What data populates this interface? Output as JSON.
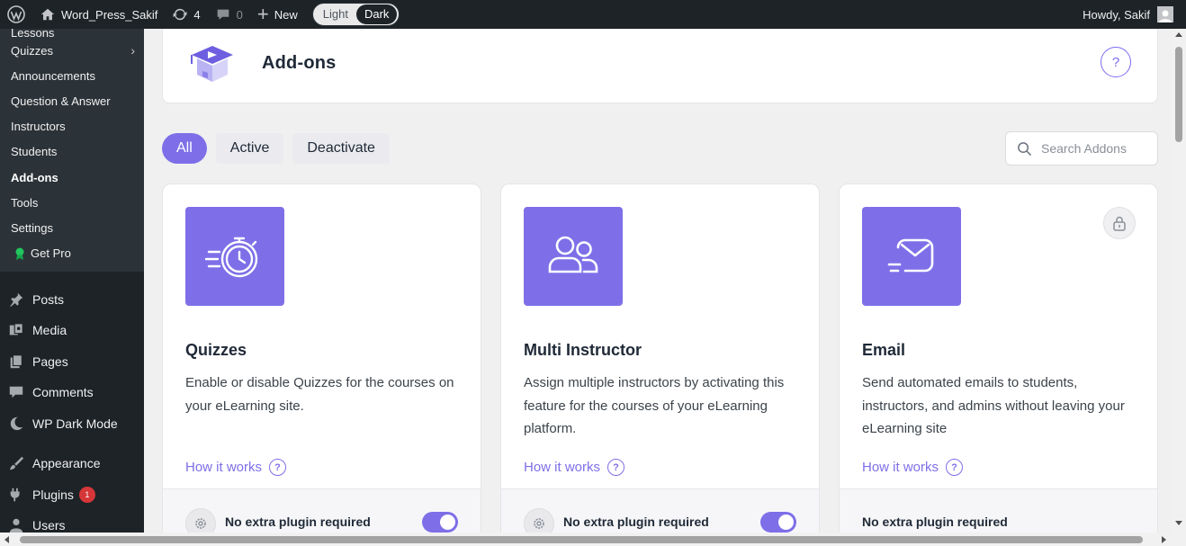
{
  "admin_bar": {
    "site_name": "Word_Press_Sakif",
    "updates_count": "4",
    "comments_count": "0",
    "new_label": "New",
    "mode_light": "Light",
    "mode_dark": "Dark",
    "greeting": "Howdy, Sakif"
  },
  "sidebar": {
    "submenu": [
      {
        "label": "Lessons"
      },
      {
        "label": "Quizzes",
        "chevron": "›"
      },
      {
        "label": "Announcements"
      },
      {
        "label": "Question & Answer"
      },
      {
        "label": "Instructors"
      },
      {
        "label": "Students"
      },
      {
        "label": "Add-ons"
      },
      {
        "label": "Tools"
      },
      {
        "label": "Settings"
      },
      {
        "label": "Get Pro"
      }
    ],
    "menu": [
      {
        "label": "Posts",
        "icon": "pin-icon"
      },
      {
        "label": "Media",
        "icon": "media-icon"
      },
      {
        "label": "Pages",
        "icon": "pages-icon"
      },
      {
        "label": "Comments",
        "icon": "comments-icon"
      },
      {
        "label": "WP Dark Mode",
        "icon": "moon-icon"
      },
      {
        "label": "Appearance",
        "icon": "brush-icon"
      },
      {
        "label": "Plugins",
        "icon": "plugin-icon",
        "badge": "1"
      },
      {
        "label": "Users",
        "icon": "user-icon"
      }
    ]
  },
  "header": {
    "title": "Add-ons",
    "help_label": "?"
  },
  "filters": {
    "all": "All",
    "active": "Active",
    "deactivate": "Deactivate"
  },
  "search": {
    "placeholder": "Search Addons"
  },
  "cards": [
    {
      "title": "Quizzes",
      "description": "Enable or disable Quizzes for the courses on your eLearning site.",
      "how_it_works": "How it works",
      "requirement": "No extra plugin required",
      "icon": "stopwatch-icon",
      "enabled": true
    },
    {
      "title": "Multi Instructor",
      "description": "Assign multiple instructors by activating this feature for the courses of your eLearning platform.",
      "how_it_works": "How it works",
      "requirement": "No extra plugin required",
      "icon": "users-icon",
      "enabled": true
    },
    {
      "title": "Email",
      "description": "Send automated emails to students, instructors, and admins without leaving your eLearning site",
      "how_it_works": "How it works",
      "requirement": "No extra plugin required",
      "icon": "envelope-icon",
      "locked": true
    }
  ],
  "colors": {
    "accent": "#7e6fe8",
    "admin_bar": "#1d2327",
    "plugin_badge": "#d63638"
  }
}
